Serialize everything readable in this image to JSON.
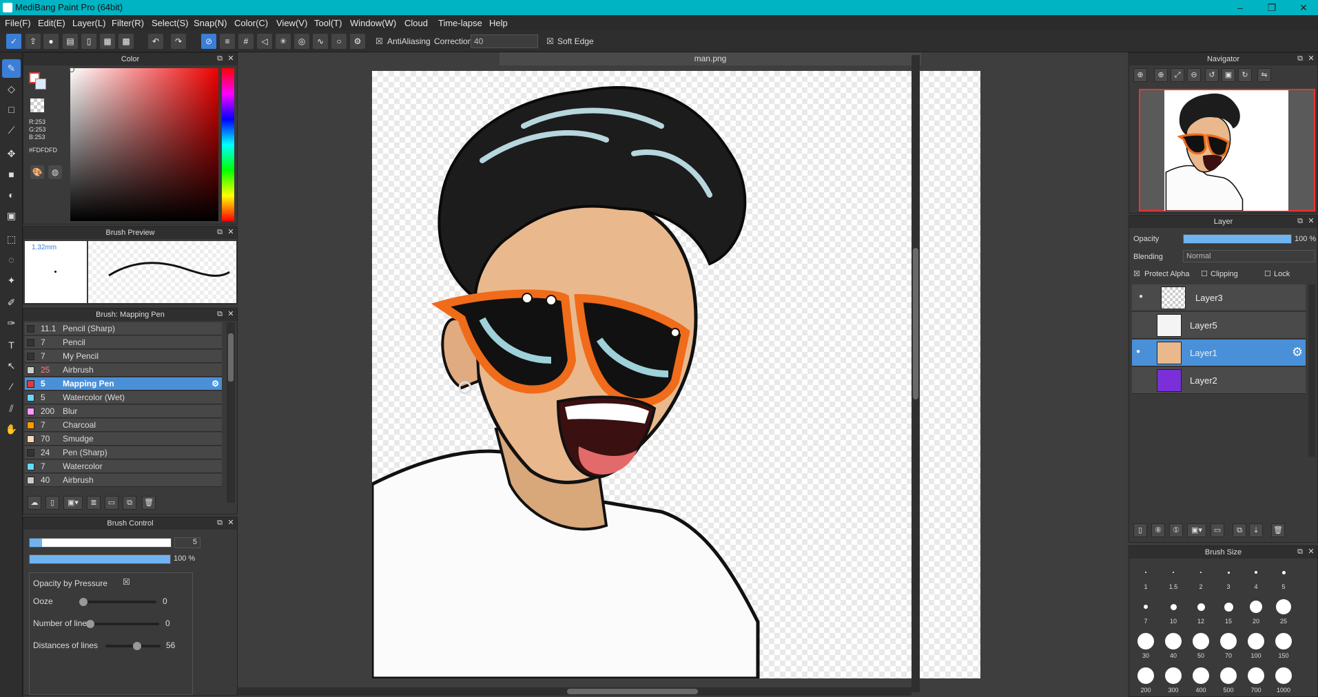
{
  "app": {
    "title": "MediBang Paint Pro (64bit)"
  },
  "menu": [
    "File(F)",
    "Edit(E)",
    "Layer(L)",
    "Filter(R)",
    "Select(S)",
    "Snap(N)",
    "Color(C)",
    "View(V)",
    "Tool(T)",
    "Window(W)",
    "Cloud",
    "Time-lapse",
    "Help"
  ],
  "toolbar": {
    "antialiasing": "AntiAliasing",
    "correction_label": "Correction",
    "correction_value": "40",
    "soft_edge": "Soft Edge"
  },
  "color_panel": {
    "title": "Color",
    "r": "R:253",
    "g": "G:253",
    "b": "B:253",
    "hex": "#FDFDFD",
    "primary": "#fdfdfd"
  },
  "brush_preview": {
    "title": "Brush Preview",
    "size": "1.32mm"
  },
  "brush_list": {
    "title": "Brush: Mapping Pen",
    "items": [
      {
        "size": "11.1",
        "name": "Pencil (Sharp)",
        "color": "#333333"
      },
      {
        "size": "7",
        "name": "Pencil",
        "color": "#333333"
      },
      {
        "size": "7",
        "name": "My Pencil",
        "color": "#333333"
      },
      {
        "size": "25",
        "name": "Airbrush",
        "color": "#cccccc"
      },
      {
        "size": "5",
        "name": "Mapping Pen",
        "color": "#e53935"
      },
      {
        "size": "5",
        "name": "Watercolor (Wet)",
        "color": "#66d9ff"
      },
      {
        "size": "200",
        "name": "Blur",
        "color": "#ff99ff"
      },
      {
        "size": "7",
        "name": "Charcoal",
        "color": "#ff9900"
      },
      {
        "size": "70",
        "name": "Smudge",
        "color": "#ffd6b3"
      },
      {
        "size": "24",
        "name": "Pen (Sharp)",
        "color": "#333333"
      },
      {
        "size": "7",
        "name": "Watercolor",
        "color": "#66d9ff"
      },
      {
        "size": "40",
        "name": "Airbrush",
        "color": "#cccccc"
      }
    ]
  },
  "brush_control": {
    "title": "Brush Control",
    "size_value": "5",
    "opacity_value": "100 %",
    "opacity_by_pressure": "Opacity by Pressure",
    "ooze_label": "Ooze",
    "ooze_value": "0",
    "lines_label": "Number of lines",
    "lines_value": "0",
    "dist_label": "Distances of lines",
    "dist_value": "56"
  },
  "canvas": {
    "tab": "man.png"
  },
  "navigator": {
    "title": "Navigator"
  },
  "layer_panel": {
    "title": "Layer",
    "opacity_label": "Opacity",
    "opacity_value": "100 %",
    "blending_label": "Blending",
    "blending_value": "Normal",
    "protect_alpha": "Protect Alpha",
    "clipping": "Clipping",
    "lock": "Lock",
    "layers": [
      {
        "name": "Layer3"
      },
      {
        "name": "Layer5"
      },
      {
        "name": "Layer1"
      },
      {
        "name": "Layer2"
      }
    ]
  },
  "brush_size": {
    "title": "Brush Size",
    "sizes": [
      "1",
      "1.5",
      "2",
      "3",
      "4",
      "5",
      "7",
      "10",
      "12",
      "15",
      "20",
      "25",
      "30",
      "40",
      "50",
      "70",
      "100",
      "150",
      "200",
      "300",
      "400",
      "500",
      "700",
      "1000"
    ]
  }
}
